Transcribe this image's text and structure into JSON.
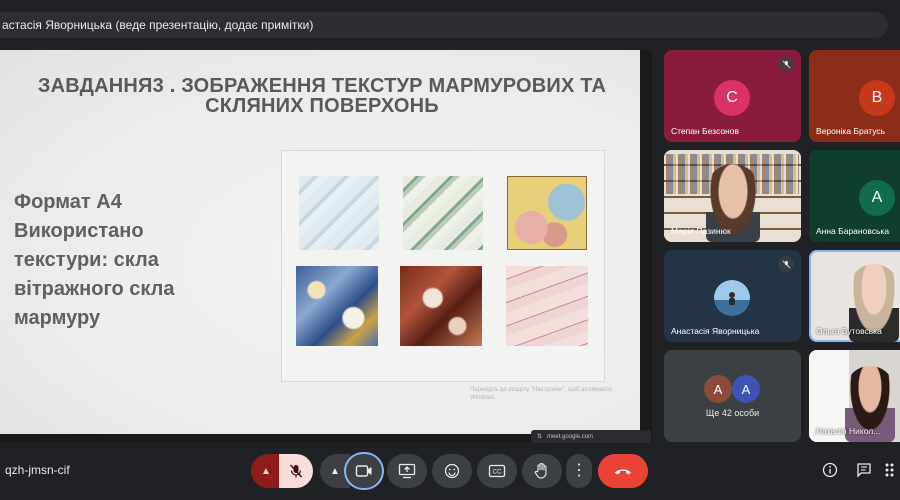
{
  "presenter_bar": {
    "label": "астасія Яворницька (веде презентацію, додає примітки)"
  },
  "slide": {
    "title_line1": "ЗАВДАННЯ3 . ЗОБРАЖЕННЯ ТЕКСТУР МАРМУРОВИХ ТА",
    "title_line2": "СКЛЯНИХ ПОВЕРХОНЬ",
    "body_lines": [
      "Формат А4",
      "Використано",
      "текстури: скла",
      "вітражного скла",
      "мармуру"
    ],
    "watermark_line1": "Перейдіть до розділу \"Настройки\", щоб активувати",
    "watermark_line2": "Windows."
  },
  "share_pill": {
    "label": "meet.google.com"
  },
  "participants": [
    {
      "name": "Степан Безсонов",
      "initial": "С",
      "muted": true,
      "bg": "#8a1c3e",
      "avatar_color": "#d93267"
    },
    {
      "name": "Вероніка Братусь",
      "initial": "В",
      "muted": false,
      "bg": "#8c2d1a",
      "avatar_color": "#c5391a"
    },
    {
      "name": "Марія Пазинюк",
      "muted": false
    },
    {
      "name": "Анна Барановська",
      "initial": "А",
      "muted": false,
      "bg": "#0f3d2e",
      "avatar_color": "#136b4d"
    },
    {
      "name": "Анастасія Яворницька",
      "muted": true,
      "bg": "#243447"
    },
    {
      "name": "Ольга Бутовська",
      "muted": false
    },
    {
      "name": "Наталія Никол...",
      "muted": false
    }
  ],
  "overflow_tile": {
    "label": "Ще 42 особи",
    "initial_a": "А",
    "initial_b": "А",
    "color_a": "#8b4a3a",
    "color_b": "#3f51b5"
  },
  "meeting": {
    "code": "qzh-jmsn-cif"
  },
  "colors": {
    "hangup": "#ea4335",
    "mic_off_bg": "#f9dedc",
    "active_outline": "#8ab4f8"
  }
}
